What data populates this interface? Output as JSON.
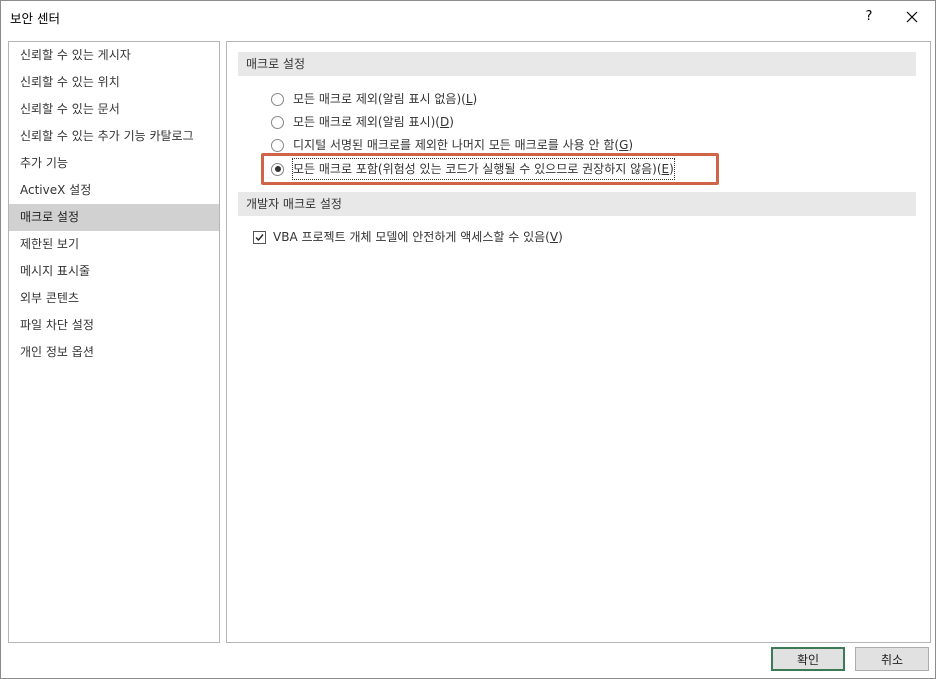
{
  "window": {
    "title": "보안 센터",
    "help": "?"
  },
  "sidebar": {
    "items": [
      {
        "label": "신뢰할 수 있는 게시자"
      },
      {
        "label": "신뢰할 수 있는 위치"
      },
      {
        "label": "신뢰할 수 있는 문서"
      },
      {
        "label": "신뢰할 수 있는 추가 기능 카탈로그"
      },
      {
        "label": "추가 기능"
      },
      {
        "label": "ActiveX 설정"
      },
      {
        "label": "매크로 설정",
        "selected": true
      },
      {
        "label": "제한된 보기"
      },
      {
        "label": "메시지 표시줄"
      },
      {
        "label": "외부 콘텐츠"
      },
      {
        "label": "파일 차단 설정"
      },
      {
        "label": "개인 정보 옵션"
      }
    ]
  },
  "macro_settings": {
    "header": "매크로 설정",
    "options": [
      {
        "text": "모든 매크로 제외(알림 표시 없음)(",
        "key": "L",
        "end": ")",
        "checked": false
      },
      {
        "text": "모든 매크로 제외(알림 표시)(",
        "key": "D",
        "end": ")",
        "checked": false
      },
      {
        "text": "디지털 서명된 매크로를 제외한 나머지 모든 매크로를 사용 안 함(",
        "key": "G",
        "end": ")",
        "checked": false
      },
      {
        "text": "모든 매크로 포함(위험성 있는 코드가 실행될 수 있으므로 권장하지 않음)(",
        "key": "E",
        "end": ")",
        "checked": true
      }
    ]
  },
  "developer_settings": {
    "header": "개발자 매크로 설정",
    "checkbox_text": "VBA 프로젝트 개체 모델에 안전하게 액세스할 수 있음(",
    "checkbox_key": "V",
    "checkbox_end": ")",
    "checked": true
  },
  "buttons": {
    "ok": "확인",
    "cancel": "취소"
  },
  "colors": {
    "highlight": "#cf6446",
    "selected_item": "#d1d1d1",
    "section_header": "#e8e8e8",
    "default_button_border": "#3c7a55"
  }
}
